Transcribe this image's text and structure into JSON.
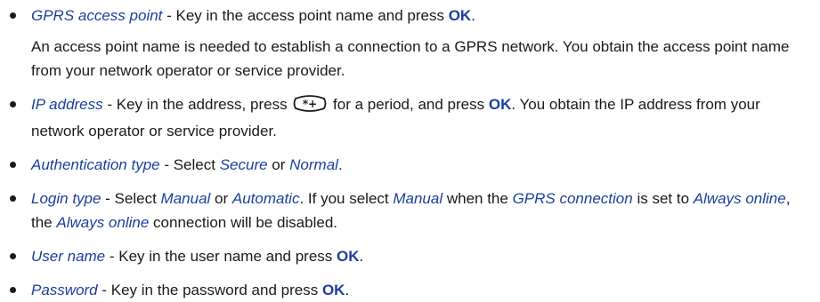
{
  "items": [
    {
      "option": "GPRS access point",
      "text1": " - Key in the access point name and press ",
      "key": "OK",
      "text2": ".",
      "note": "An access point name is needed to establish a connection to a GPRS network. You obtain the access point name from your network operator or service provider."
    },
    {
      "option": "IP address",
      "text1": " - Key in the address, press ",
      "key_icon": "star-plus-key-icon",
      "text2": " for a period, and press ",
      "key": "OK",
      "text3": ". You obtain the IP address from your network operator or service provider."
    },
    {
      "option": "Authentication type",
      "text1": " - Select ",
      "choice1": "Secure",
      "text2": " or ",
      "choice2": "Normal",
      "text3": "."
    },
    {
      "option": "Login type",
      "text1": " - Select ",
      "choice1": "Manual",
      "text2": " or ",
      "choice2": "Automatic",
      "text3": ". If you select ",
      "choice3": "Manual",
      "text4": " when the ",
      "choice4": "GPRS connection",
      "text5": " is set to ",
      "choice5": "Always online",
      "text6": ", the ",
      "choice6": "Always online",
      "text7": " connection will be disabled."
    },
    {
      "option": "User name",
      "text1": " - Key in the user name and press ",
      "key": "OK",
      "text2": "."
    },
    {
      "option": "Password",
      "text1": " - Key in the password and press ",
      "key": "OK",
      "text2": "."
    }
  ],
  "colors": {
    "option": "#1b3f9e",
    "text": "#1a1a1a"
  }
}
